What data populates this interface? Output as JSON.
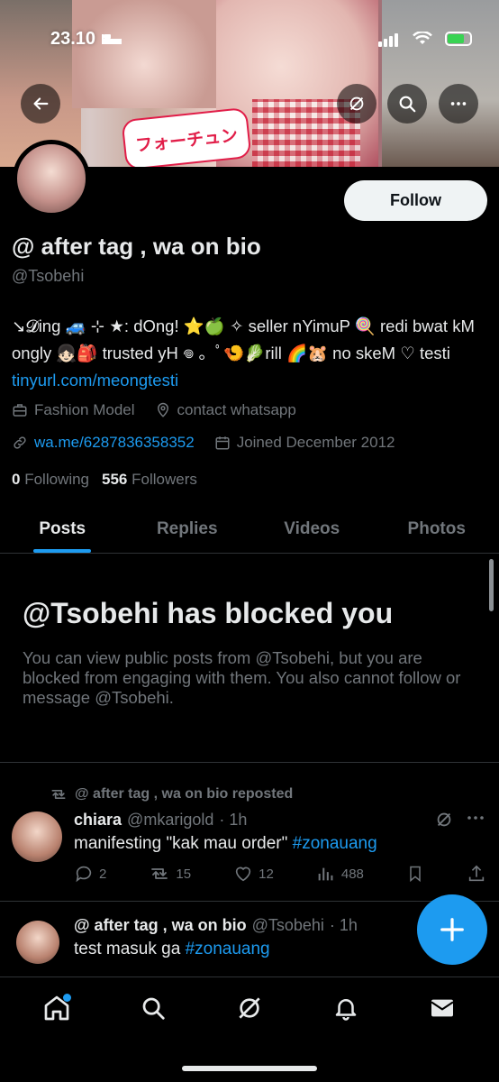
{
  "status_bar": {
    "time": "23.10"
  },
  "profile": {
    "display_name": "@ after tag , wa on bio",
    "handle": "@Tsobehi",
    "follow_label": "Follow",
    "bio_text": "↘𝓓ing 🚙 ⊹ ★: dOng! ⭐🍏 ✧ seller nYimuP 🍭 redi bwat kM ongly 👧🏻🎒 trusted yH 𖦹 。ﾟ🍤🥬rill 🌈🐹 no skeM ♡ testi ",
    "bio_link": "tinyurl.com/meongtesti",
    "category": "Fashion Model",
    "location": "contact whatsapp",
    "website": "wa.me/6287836358352",
    "joined": "Joined December 2012",
    "following_count": "0",
    "following_label": "Following",
    "followers_count": "556",
    "followers_label": "Followers"
  },
  "tabs": [
    {
      "label": "Posts"
    },
    {
      "label": "Replies"
    },
    {
      "label": "Videos"
    },
    {
      "label": "Photos"
    }
  ],
  "blocked": {
    "title": "@Tsobehi has blocked you",
    "text": "You can view public posts from @Tsobehi, but you are blocked from engaging with them. You also cannot follow or message @Tsobehi."
  },
  "posts": [
    {
      "repost_label": "@ after tag , wa on bio reposted",
      "author_name": "chiara",
      "author_handle": "@mkarigold",
      "time": "· 1h",
      "text": "manifesting \"kak mau order\" ",
      "hashtag": "#zonauang",
      "replies": "2",
      "reposts": "15",
      "likes": "12",
      "views": "488"
    },
    {
      "author_name": "@ after tag , wa on bio",
      "author_handle": "@Tsobehi",
      "time": "· 1h",
      "text": "test masuk ga ",
      "hashtag": "#zonauang"
    }
  ],
  "banner_sticker": "フォーチュン",
  "colors": {
    "accent": "#1d9bf0",
    "background": "#000000",
    "muted": "#71767b",
    "text": "#e7e9ea"
  }
}
